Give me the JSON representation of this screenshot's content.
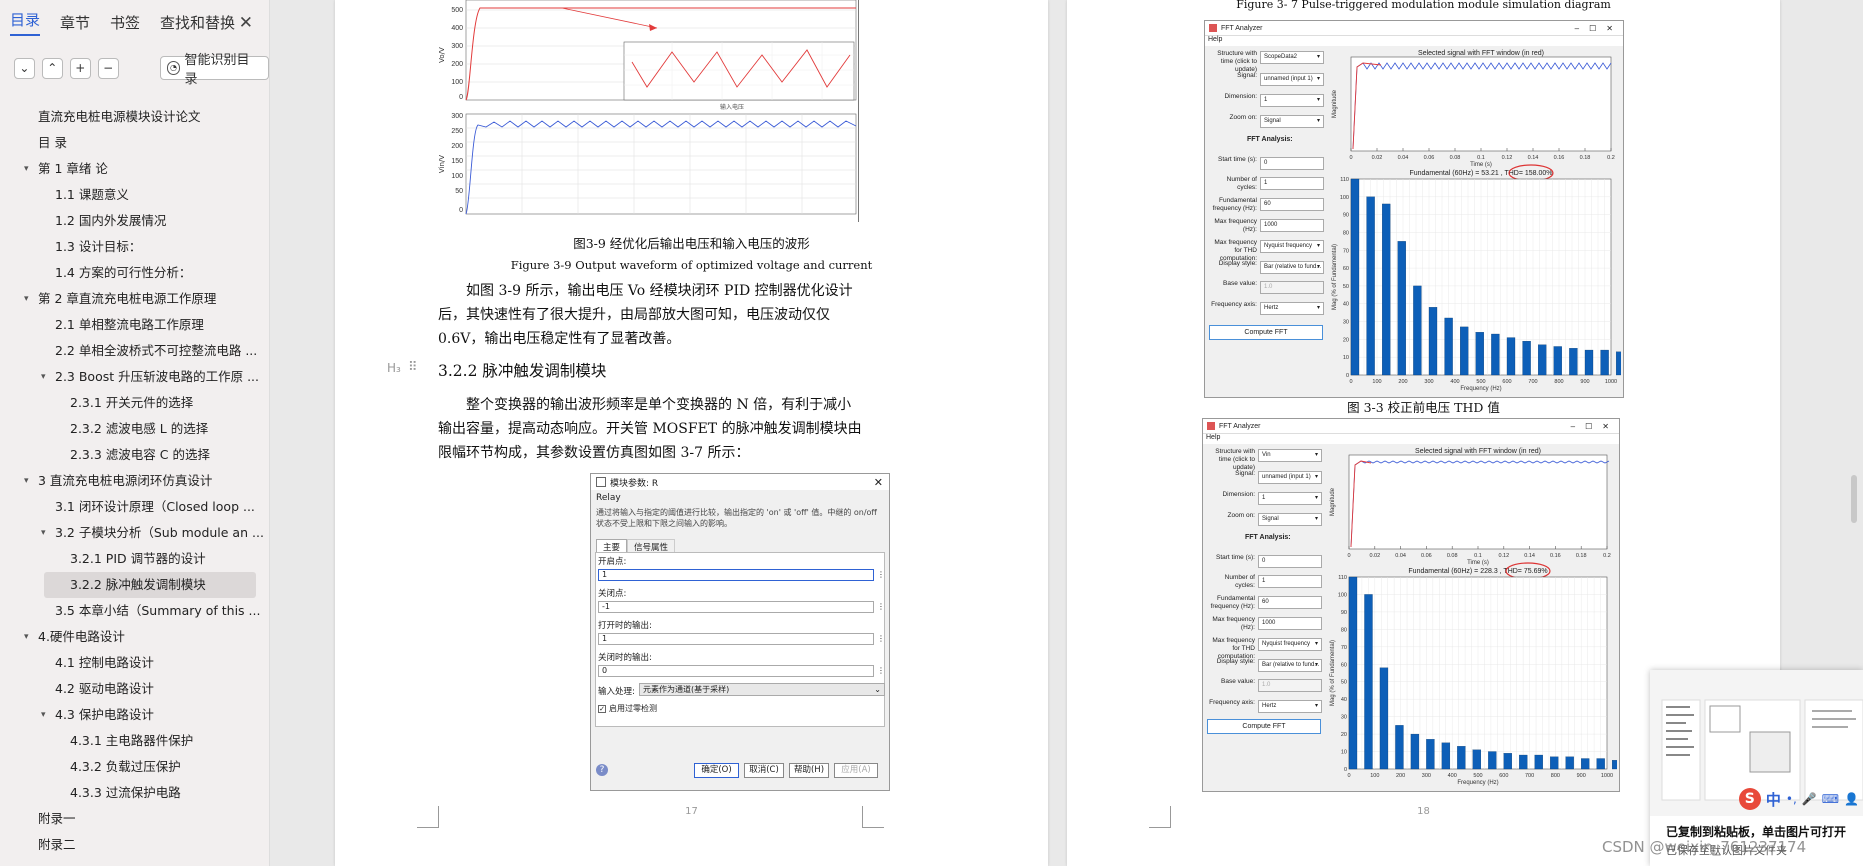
{
  "sidebar": {
    "tabs": [
      "目录",
      "章节",
      "书签",
      "查找和替换"
    ],
    "smart_toc_label": "智能识别目录",
    "toc": [
      {
        "label": "直流充电桩电源模块设计论文",
        "level": 0,
        "arrow": ""
      },
      {
        "label": "目  录",
        "level": 0,
        "arrow": ""
      },
      {
        "label": "第 1 章绪  论",
        "level": 0,
        "arrow": "▾"
      },
      {
        "label": "1.1  课题意义",
        "level": 1,
        "arrow": ""
      },
      {
        "label": "1.2  国内外发展情况",
        "level": 1,
        "arrow": ""
      },
      {
        "label": "1.3  设计目标：",
        "level": 1,
        "arrow": ""
      },
      {
        "label": "1.4  方案的可行性分析：",
        "level": 1,
        "arrow": ""
      },
      {
        "label": "第 2 章直流充电桩电源工作原理",
        "level": 0,
        "arrow": "▾"
      },
      {
        "label": "2.1  单相整流电路工作原理",
        "level": 1,
        "arrow": ""
      },
      {
        "label": "2.2 单相全波桥式不可控整流电路 ...",
        "level": 1,
        "arrow": ""
      },
      {
        "label": "2.3 Boost 升压斩波电路的工作原 ...",
        "level": 1,
        "arrow": "▾"
      },
      {
        "label": "2.3.1  开关元件的选择",
        "level": 2,
        "arrow": ""
      },
      {
        "label": "2.3.2  滤波电感 L 的选择",
        "level": 2,
        "arrow": ""
      },
      {
        "label": "2.3.3  滤波电容 C 的选择",
        "level": 2,
        "arrow": ""
      },
      {
        "label": "3  直流充电桩电源闭环仿真设计",
        "level": 0,
        "arrow": "▾"
      },
      {
        "label": "3.1  闭环设计原理（Closed loop  ...",
        "level": 1,
        "arrow": ""
      },
      {
        "label": "3.2  子模块分析（Sub module an ...",
        "level": 1,
        "arrow": "▾"
      },
      {
        "label": "3.2.1 PID 调节器的设计",
        "level": 2,
        "arrow": ""
      },
      {
        "label": "3.2.2  脉冲触发调制模块",
        "level": 2,
        "arrow": "",
        "selected": true
      },
      {
        "label": "3.5  本章小结（Summary of this  ...",
        "level": 1,
        "arrow": ""
      },
      {
        "label": "4.硬件电路设计",
        "level": 0,
        "arrow": "▾"
      },
      {
        "label": "4.1  控制电路设计",
        "level": 1,
        "arrow": ""
      },
      {
        "label": "4.2  驱动电路设计",
        "level": 1,
        "arrow": ""
      },
      {
        "label": "4.3  保护电路设计",
        "level": 1,
        "arrow": "▾"
      },
      {
        "label": "4.3.1  主电路器件保护",
        "level": 2,
        "arrow": ""
      },
      {
        "label": "4.3.2  负载过压保护",
        "level": 2,
        "arrow": ""
      },
      {
        "label": "4.3.3  过流保护电路",
        "level": 2,
        "arrow": ""
      },
      {
        "label": "附录一",
        "level": 0,
        "arrow": ""
      },
      {
        "label": "附录二",
        "level": 0,
        "arrow": ""
      }
    ]
  },
  "page17": {
    "fig_caption_cn": "图3-9  经优化后输出电压和输入电压的波形",
    "fig_caption_en": "Figure 3-9 Output waveform of optimized voltage and current",
    "paragraph1": "如图 3-9 所示，输出电压 Vo 经模块闭环 PID 控制器优化设计后，其快速性有了很大提升，由局部放大图可知，电压波动仅仅 0.6V，输出电压稳定性有了显著改善。",
    "heading_marker": "H₃",
    "heading": "3.2.2  脉冲触发调制模块",
    "paragraph2": "整个变换器的输出波形频率是单个变换器的 N 倍，有利于减小输出容量，提高动态响应。开关管 MOSFET 的脉冲触发调制模块由限幅环节构成，其参数设置仿真图如图 3-7 所示：",
    "page_number": "17",
    "plot_top": {
      "ylabel": "Vo/V",
      "ticks": [
        "500",
        "400",
        "300",
        "200",
        "100",
        "0"
      ],
      "inset_xlabel": "输入电压"
    },
    "plot_bottom": {
      "ylabel": "Vin/V",
      "ticks": [
        "300",
        "250",
        "200",
        "150",
        "100",
        "50",
        "0"
      ]
    },
    "dialog": {
      "title": "模块参数: R",
      "block_name": "Relay",
      "description": "通过将输入与指定的阈值进行比较，输出指定的 'on' 或 'off' 值。中继的 on/off 状态不受上限和下限之间输入的影响。",
      "tabs": [
        "主要",
        "信号属性"
      ],
      "fields": [
        {
          "label": "开启点:",
          "value": "1"
        },
        {
          "label": "关闭点:",
          "value": "-1"
        },
        {
          "label": "打开时的输出:",
          "value": "1"
        },
        {
          "label": "关闭时的输出:",
          "value": "0"
        }
      ],
      "input_processing_label": "输入处理:",
      "input_processing_value": "元素作为通道(基于采样)",
      "zero_crossing_label": "启用过零检测",
      "buttons": [
        "确定(O)",
        "取消(C)",
        "帮助(H)",
        "应用(A)"
      ]
    }
  },
  "page18": {
    "top_caption": "Figure 3- 7 Pulse-triggered modulation module simulation diagram",
    "bottom_caption": "图 3-3  校正前电压 THD 值",
    "page_number": "18",
    "fft_windows": [
      {
        "title": "FFT Analyzer",
        "menu": "Help",
        "structure_label": "Structure with time (click to update)",
        "structure_value": "ScopeData2",
        "signal_label": "Signal:",
        "signal_value": "unnamed (input 1)",
        "dimension_label": "Dimension:",
        "dimension_value": "1",
        "zoom_label": "Zoom on:",
        "zoom_value": "Signal",
        "analysis_header": "FFT Analysis:",
        "start_label": "Start time (s):",
        "start_value": "0",
        "cycles_label": "Number of cycles:",
        "cycles_value": "1",
        "fund_label": "Fundamental frequency (Hz):",
        "fund_value": "60",
        "maxf_label": "Max frequency (Hz):",
        "maxf_value": "1000",
        "thdmax_label": "Max frequency for THD computation:",
        "thdmax_value": "Nyquist frequency",
        "display_label": "Display style:",
        "display_value": "Bar (relative to fund...",
        "base_label": "Base value:",
        "base_value": "1.0",
        "axis_label": "Frequency axis:",
        "axis_value": "Hertz",
        "compute_button": "Compute FFT",
        "signal_plot_title": "Selected signal with FFT window (in red)",
        "time_xlabel": "Time (s)",
        "magnitude_ylabel": "Magnitude",
        "fft_title": "Fundamental (60Hz) = 53.21 , THD= 158.00%",
        "fft_ylabel": "Mag (% of Fundamental)",
        "fft_xlabel": "Frequency (Hz)",
        "bars": [
          110,
          100,
          96,
          75,
          50,
          38,
          32,
          27,
          24,
          23,
          21,
          19,
          17,
          16,
          15,
          14,
          14,
          13
        ]
      },
      {
        "title": "FFT Analyzer",
        "menu": "Help",
        "structure_label": "Structure with time (click to update)",
        "structure_value": "Vin",
        "signal_label": "Signal:",
        "signal_value": "unnamed (input 1)",
        "dimension_label": "Dimension:",
        "dimension_value": "1",
        "zoom_label": "Zoom on:",
        "zoom_value": "Signal",
        "analysis_header": "FFT Analysis:",
        "start_label": "Start time (s):",
        "start_value": "0",
        "cycles_label": "Number of cycles:",
        "cycles_value": "1",
        "fund_label": "Fundamental frequency (Hz):",
        "fund_value": "60",
        "maxf_label": "Max frequency (Hz):",
        "maxf_value": "1000",
        "thdmax_label": "Max frequency for THD computation:",
        "thdmax_value": "Nyquist frequency",
        "display_label": "Display style:",
        "display_value": "Bar (relative to fund...",
        "base_label": "Base value:",
        "base_value": "1.0",
        "axis_label": "Frequency axis:",
        "axis_value": "Hertz",
        "compute_button": "Compute FFT",
        "signal_plot_title": "Selected signal with FFT window (in red)",
        "time_xlabel": "Time (s)",
        "magnitude_ylabel": "Magnitude",
        "fft_title": "Fundamental (60Hz) = 228.3 , THD= 75.69%",
        "fft_ylabel": "Mag (% of Fundamental)",
        "fft_xlabel": "Frequency (Hz)",
        "bars": [
          110,
          100,
          58,
          25,
          20,
          17,
          15,
          13,
          11,
          10,
          9,
          8,
          8,
          7,
          7,
          6,
          6,
          5
        ]
      }
    ],
    "time_ticks": [
      "0",
      "0.02",
      "0.04",
      "0.06",
      "0.08",
      "0.1",
      "0.12",
      "0.14",
      "0.16",
      "0.18",
      "0.2"
    ],
    "freq_ticks": [
      "0",
      "100",
      "200",
      "300",
      "400",
      "500",
      "600",
      "700",
      "800",
      "900",
      "1000"
    ]
  },
  "clipboard_popup": {
    "message": "已复制到粘贴板，单击图片可打开",
    "sub": "已保存至默认图片文件夹"
  },
  "ime_label": "中",
  "watermark": "CSDN @weixin_761237174",
  "colors": {
    "accent": "#2f62d4",
    "plot_red": "#e23b3b",
    "plot_blue": "#3b5bd6",
    "bar_blue": "#0d5fb8"
  }
}
